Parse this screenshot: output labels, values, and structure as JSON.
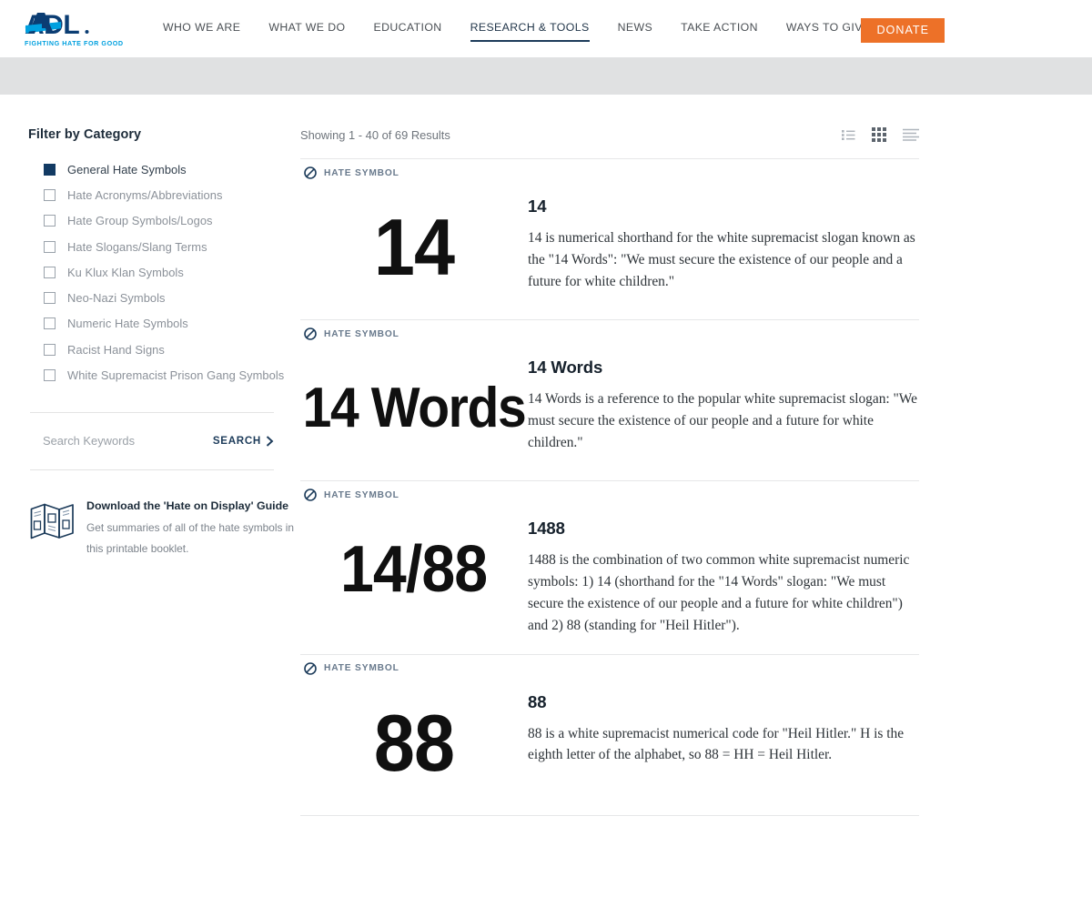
{
  "header": {
    "logo": {
      "text": "ADL",
      "tagline": "FIGHTING HATE FOR GOOD",
      "registered": "®"
    },
    "nav": [
      {
        "label": "WHO WE ARE",
        "active": false
      },
      {
        "label": "WHAT WE DO",
        "active": false
      },
      {
        "label": "EDUCATION",
        "active": false
      },
      {
        "label": "RESEARCH & TOOLS",
        "active": true
      },
      {
        "label": "NEWS",
        "active": false
      },
      {
        "label": "TAKE ACTION",
        "active": false
      },
      {
        "label": "WAYS TO GIVE",
        "active": false
      }
    ],
    "search_icon": "search-icon",
    "donate_label": "DONATE",
    "donate_color": "#ED7128",
    "accent_navy": "#1C3B5A",
    "logo_blue": "#00A0DF"
  },
  "sidebar": {
    "filter_title": "Filter by Category",
    "categories": [
      {
        "label": "General Hate Symbols",
        "checked": true
      },
      {
        "label": "Hate Acronyms/Abbreviations",
        "checked": false
      },
      {
        "label": "Hate Group Symbols/Logos",
        "checked": false
      },
      {
        "label": "Hate Slogans/Slang Terms",
        "checked": false
      },
      {
        "label": "Ku Klux Klan Symbols",
        "checked": false
      },
      {
        "label": "Neo-Nazi Symbols",
        "checked": false
      },
      {
        "label": "Numeric Hate Symbols",
        "checked": false
      },
      {
        "label": "Racist Hand Signs",
        "checked": false
      },
      {
        "label": "White Supremacist Prison Gang Symbols",
        "checked": false
      }
    ],
    "search": {
      "placeholder": "Search Keywords",
      "value": "",
      "button_label": "SEARCH"
    },
    "promo": {
      "title": "Download the 'Hate on Display' Guide",
      "text": "Get summaries of all of the hate symbols in this printable booklet.",
      "icon": "brochure-icon"
    }
  },
  "results": {
    "count_text": "Showing 1 - 40 of 69 Results",
    "views": [
      {
        "name": "list-view",
        "active": false
      },
      {
        "name": "grid-view",
        "active": true
      },
      {
        "name": "compact-view",
        "active": false
      }
    ],
    "badge_label": "HATE SYMBOL",
    "items": [
      {
        "glyph": "14",
        "glyph_style": "plain",
        "title": "14",
        "description": "14 is numerical shorthand for the white supremacist slogan known as the \"14 Words\": \"We must secure the existence of our people and a future for white children.\""
      },
      {
        "glyph": "14 Words",
        "glyph_style": "words",
        "title": "14 Words",
        "description": "14 Words is a reference to the popular white supremacist slogan: \"We must secure the existence of our people and a future for white children.\""
      },
      {
        "glyph": "14/88",
        "glyph_style": "slash",
        "title": "1488",
        "description": "1488 is the combination of two common white supremacist numeric symbols: 1) 14 (shorthand for the \"14 Words\" slogan: \"We must secure the existence of our people and a future for white children\") and 2) 88 (standing for \"Heil Hitler\")."
      },
      {
        "glyph": "88",
        "glyph_style": "plain",
        "title": "88",
        "description": "88 is a white supremacist numerical code for \"Heil Hitler.\" H is the eighth letter of the alphabet, so 88 = HH = Heil Hitler."
      }
    ]
  }
}
